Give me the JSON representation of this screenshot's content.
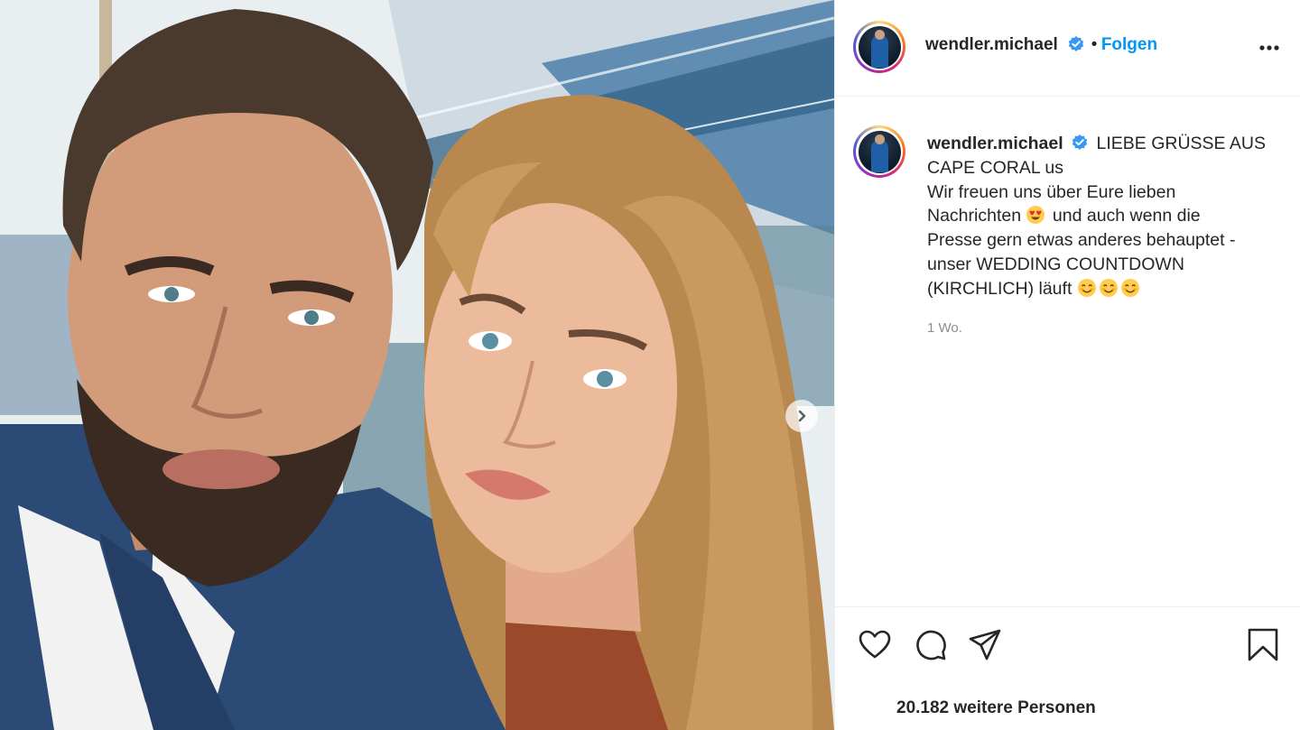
{
  "post": {
    "username": "wendler.michael",
    "follow_label": "Folgen",
    "separator": "•",
    "verified": true,
    "caption_line1": "LIEBE GRÜSSE AUS",
    "caption_line2": "CAPE CORAL us",
    "caption_line3": "Wir freuen uns über Eure lieben",
    "caption_line4a": "Nachrichten",
    "caption_line4b": "und auch wenn die",
    "caption_line5": "Presse gern etwas anderes behauptet -",
    "caption_line6": "unser WEDDING COUNTDOWN",
    "caption_line7": "(KIRCHLICH) läuft",
    "timestamp": "1 Wo.",
    "likes_text": "20.182 weitere Personen"
  },
  "icons": {
    "like": "heart-icon",
    "comment": "comment-icon",
    "share": "paper-plane-icon",
    "save": "bookmark-icon",
    "more": "more-options-icon",
    "next": "chevron-right-icon",
    "verified": "verified-badge-icon",
    "emoji_heart_eyes": "heart-eyes-emoji",
    "emoji_smile": "smiling-face-emoji"
  },
  "colors": {
    "link": "#0095f6",
    "verified": "#3897f0",
    "muted": "#8e8e8e",
    "text": "#262626"
  }
}
